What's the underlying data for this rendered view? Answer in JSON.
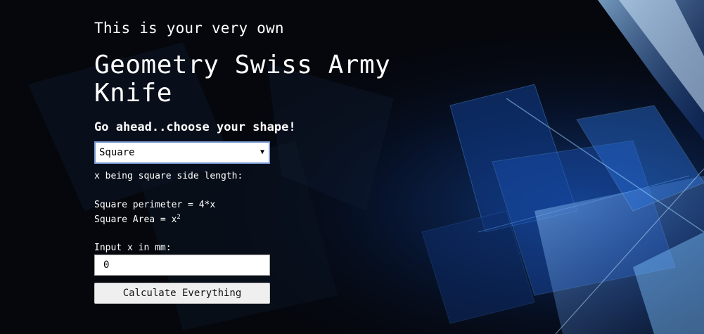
{
  "header": {
    "intro": "This is your very own",
    "title": "Geometry Swiss Army Knife",
    "subtitle": "Go ahead..choose your shape!"
  },
  "shape_select": {
    "selected": "Square",
    "arrow_icon": "triangle-down"
  },
  "description": {
    "definition": "x being square side length:",
    "perimeter_formula": "Square perimeter = 4*x",
    "area_formula_prefix": "Square Area = x",
    "area_formula_exponent": "2"
  },
  "input": {
    "label": "Input x in mm:",
    "value": "0"
  },
  "button": {
    "label": "Calculate Everything"
  },
  "colors": {
    "background": "#05070d",
    "accent_blue": "#3d8fff",
    "text": "#ffffff"
  }
}
